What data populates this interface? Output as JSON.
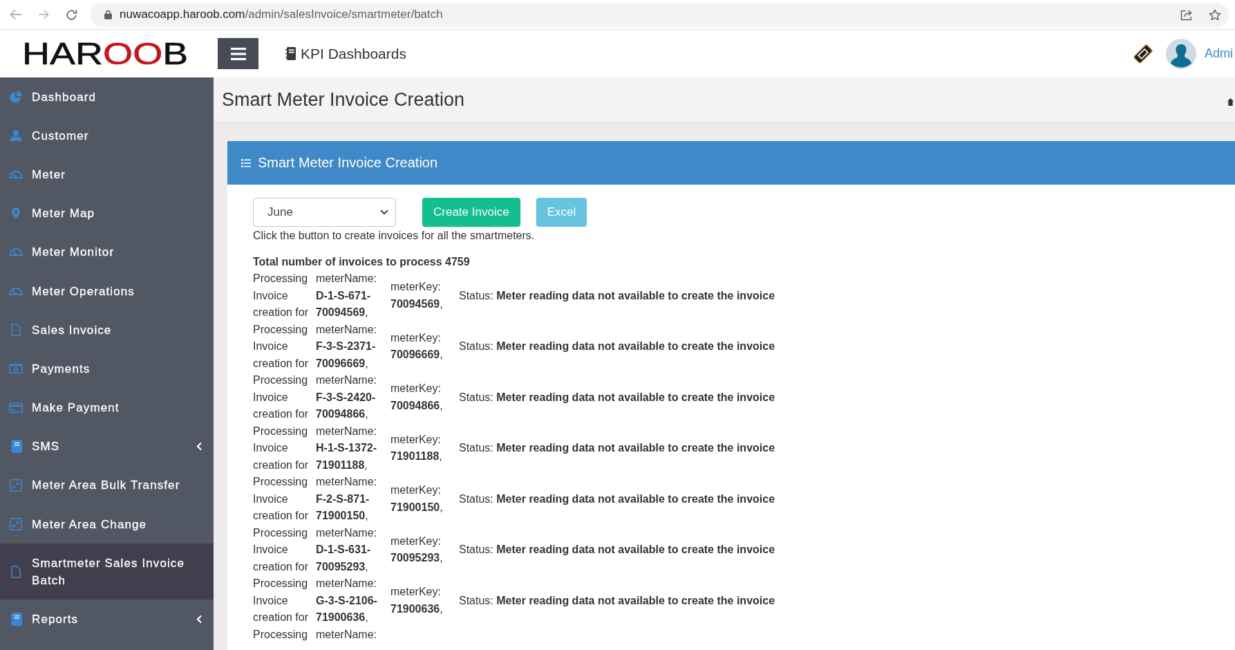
{
  "browser": {
    "back": {
      "disabled": true
    },
    "forward": {
      "disabled": true
    },
    "url": {
      "host": "nuwacoapp.haroob.com",
      "path": "/admin/salesInvoice/smartmeter/batch"
    }
  },
  "header": {
    "logo": {
      "lead": "HAR",
      "rings": "OO",
      "tail": "B"
    },
    "nav_link": "KPI Dashboards",
    "user_name": "Admi"
  },
  "sidebar": {
    "items": [
      {
        "label": "Dashboard",
        "selected": false,
        "submenu": false
      },
      {
        "label": "Customer",
        "selected": false,
        "submenu": false
      },
      {
        "label": "Meter",
        "selected": false,
        "submenu": false
      },
      {
        "label": "Meter Map",
        "selected": false,
        "submenu": false
      },
      {
        "label": "Meter Monitor",
        "selected": false,
        "submenu": false
      },
      {
        "label": "Meter Operations",
        "selected": false,
        "submenu": false
      },
      {
        "label": "Sales Invoice",
        "selected": false,
        "submenu": false
      },
      {
        "label": "Payments",
        "selected": false,
        "submenu": false
      },
      {
        "label": "Make Payment",
        "selected": false,
        "submenu": false
      },
      {
        "label": "SMS",
        "selected": false,
        "submenu": true
      },
      {
        "label": "Meter Area Bulk Transfer",
        "selected": false,
        "submenu": false
      },
      {
        "label": "Meter Area Change",
        "selected": false,
        "submenu": false
      },
      {
        "label": "Smartmeter Sales Invoice Batch",
        "selected": true,
        "submenu": false
      },
      {
        "label": "Reports",
        "selected": false,
        "submenu": true
      }
    ]
  },
  "page_header": {
    "title": "Smart Meter Invoice Creation"
  },
  "panel": {
    "title": "Smart Meter Invoice Creation",
    "month_select": {
      "value": "June"
    },
    "buttons": [
      {
        "label": "Create Invoice",
        "kind": "success"
      },
      {
        "label": "Excel",
        "kind": "info"
      }
    ],
    "hint": "Click the button to create invoices for all the smartmeters.",
    "total": "Total number of invoices to process 4759",
    "log_rows": [
      {
        "action": "Processing Invoice creation for",
        "meter_name": "meterName: **D-1-S-671-70094569**,",
        "meter_key": "meterKey: **70094569**,",
        "status": "Status: **Meter reading data not available to create the invoice**"
      },
      {
        "action": "Processing Invoice creation for",
        "meter_name": "meterName: **F-3-S-2371-70096669**,",
        "meter_key": "meterKey: **70096669**,",
        "status": "Status: **Meter reading data not available to create the invoice**"
      },
      {
        "action": "Processing Invoice creation for",
        "meter_name": "meterName: **F-3-S-2420-70094866**,",
        "meter_key": "meterKey: **70094866**,",
        "status": "Status: **Meter reading data not available to create the invoice**"
      },
      {
        "action": "Processing Invoice creation for",
        "meter_name": "meterName: **H-1-S-1372-71901188**,",
        "meter_key": "meterKey: **71901188**,",
        "status": "Status: **Meter reading data not available to create the invoice**"
      },
      {
        "action": "Processing Invoice creation for",
        "meter_name": "meterName: **F-2-S-871-71900150**,",
        "meter_key": "meterKey: **71900150**,",
        "status": "Status: **Meter reading data not available to create the invoice**"
      },
      {
        "action": "Processing Invoice creation for",
        "meter_name": "meterName: **D-1-S-631-70095293**,",
        "meter_key": "meterKey: **70095293**,",
        "status": "Status: **Meter reading data not available to create the invoice**"
      },
      {
        "action": "Processing Invoice creation for",
        "meter_name": "meterName: **G-3-S-2106-71900636**,",
        "meter_key": "meterKey: **71900636**,",
        "status": "Status: **Meter reading data not available to create the invoice**"
      },
      {
        "action": "Processing",
        "meter_name": "meterName:"
      }
    ]
  }
}
